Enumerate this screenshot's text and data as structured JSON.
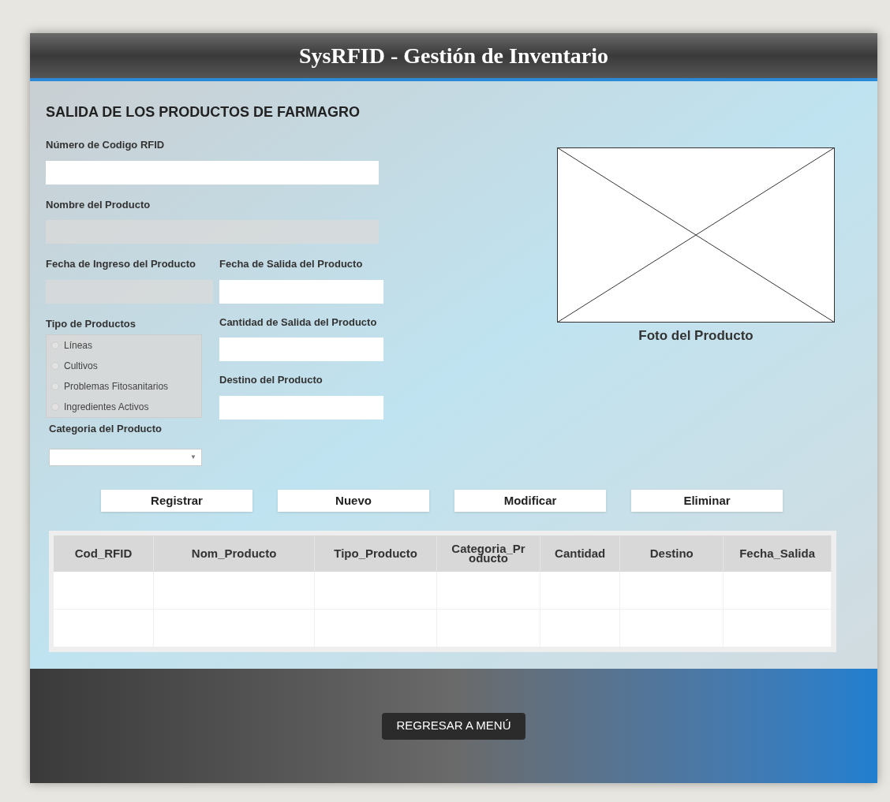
{
  "window": {
    "title": "SysRFID - Gestión de Inventario"
  },
  "form": {
    "heading": "SALIDA DE LOS PRODUCTOS DE FARMAGRO",
    "rfid": {
      "label": "Número de Codigo RFID",
      "disabled": false
    },
    "nombre": {
      "label": "Nombre del Producto",
      "disabled": true
    },
    "fecha_ingreso": {
      "label": "Fecha de Ingreso del Producto",
      "disabled": true
    },
    "fecha_salida": {
      "label": "Fecha de Salida del Producto",
      "disabled": false
    },
    "tipo": {
      "label": "Tipo de Productos",
      "options": [
        {
          "label": "Líneas",
          "selected": false
        },
        {
          "label": "Cultivos",
          "selected": false
        },
        {
          "label": "Problemas Fitosanitarios",
          "selected": false
        },
        {
          "label": "Ingredientes Activos",
          "selected": false
        }
      ]
    },
    "cantidad": {
      "label": "Cantidad de Salida del Producto",
      "disabled": false
    },
    "destino": {
      "label": "Destino del Producto",
      "disabled": false
    },
    "categoria": {
      "label": "Categoria del Producto",
      "arrow": "▼"
    },
    "photo": {
      "caption": "Foto del Producto"
    }
  },
  "buttons": [
    "Registrar",
    "Nuevo",
    "Modificar",
    "Eliminar"
  ],
  "table": {
    "columns": [
      "Cod_RFID",
      "Nom_Producto",
      "Tipo_Producto",
      "Categoria_Producto",
      "Cantidad",
      "Destino",
      "Fecha_Salida"
    ]
  },
  "footer": {
    "button": "REGRESAR A MENÚ"
  }
}
